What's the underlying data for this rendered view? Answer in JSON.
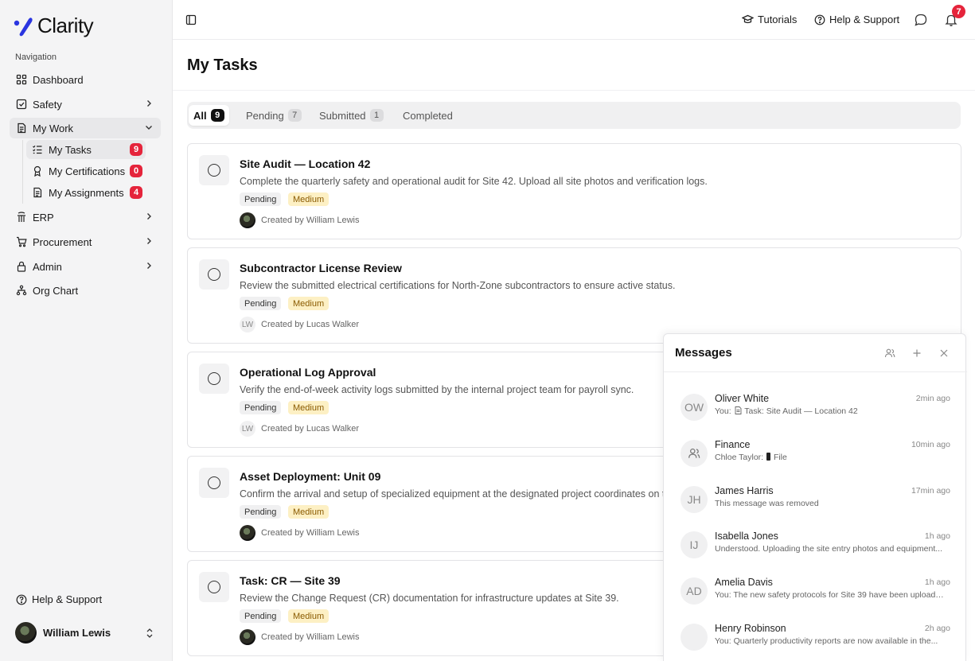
{
  "app": {
    "name": "Clarity"
  },
  "colors": {
    "brand": "#2a35e0",
    "badge_red": "#e5243b",
    "priority_bg": "#fdf0c4"
  },
  "sidebar": {
    "caption": "Navigation",
    "items": [
      {
        "label": "Dashboard",
        "icon": "grid-icon"
      },
      {
        "label": "Safety",
        "icon": "checkbox-icon"
      },
      {
        "label": "My Work",
        "icon": "document-icon"
      },
      {
        "label": "ERP",
        "icon": "plant-icon"
      },
      {
        "label": "Procurement",
        "icon": "cart-icon"
      },
      {
        "label": "Admin",
        "icon": "lock-icon"
      },
      {
        "label": "Org Chart",
        "icon": "hierarchy-icon"
      }
    ],
    "sub_items": [
      {
        "label": "My Tasks",
        "count": "9",
        "icon": "tasks-list-icon"
      },
      {
        "label": "My Certifications",
        "count": "0",
        "icon": "award-icon"
      },
      {
        "label": "My Assignments",
        "count": "4",
        "icon": "clipboard-icon"
      }
    ],
    "help_label": "Help & Support",
    "user_name": "William Lewis"
  },
  "topbar": {
    "tutorials_label": "Tutorials",
    "help_label": "Help & Support",
    "notification_count": "7"
  },
  "page": {
    "title": "My Tasks",
    "tabs": [
      {
        "label": "All",
        "count": "9"
      },
      {
        "label": "Pending",
        "count": "7"
      },
      {
        "label": "Submitted",
        "count": "1"
      },
      {
        "label": "Completed",
        "count": ""
      }
    ]
  },
  "tasks": [
    {
      "title": "Site Audit — Location 42",
      "description": "Complete the quarterly safety and operational audit for Site 42. Upload all site photos and verification logs.",
      "status": "Pending",
      "priority": "Medium",
      "creator": "Created by William Lewis",
      "creator_initials": ""
    },
    {
      "title": "Subcontractor License Review",
      "description": "Review the submitted electrical certifications for North-Zone subcontractors to ensure active status.",
      "status": "Pending",
      "priority": "Medium",
      "creator": "Created by Lucas Walker",
      "creator_initials": "LW"
    },
    {
      "title": "Operational Log Approval",
      "description": "Verify the end-of-week activity logs submitted by the internal project team for payroll sync.",
      "status": "Pending",
      "priority": "Medium",
      "creator": "Created by Lucas Walker",
      "creator_initials": "LW"
    },
    {
      "title": "Asset Deployment: Unit 09",
      "description": "Confirm the arrival and setup of specialized equipment at the designated project coordinates on th",
      "status": "Pending",
      "priority": "Medium",
      "creator": "Created by William Lewis",
      "creator_initials": ""
    },
    {
      "title": "Task: CR — Site 39",
      "description": "Review the Change Request (CR) documentation for infrastructure updates at Site 39.",
      "status": "Pending",
      "priority": "Medium",
      "creator": "Created by William Lewis",
      "creator_initials": ""
    }
  ],
  "messages": {
    "title": "Messages",
    "items": [
      {
        "name": "Oliver White",
        "initials": "OW",
        "time": "2min ago",
        "preview_prefix": "You:",
        "preview": "Task: Site Audit — Location 42",
        "preview_icon": "document-icon"
      },
      {
        "name": "Finance",
        "initials": "",
        "time": "10min ago",
        "preview_prefix": "Chloe Taylor:",
        "preview": "File",
        "preview_icon": "phone-icon"
      },
      {
        "name": "James Harris",
        "initials": "JH",
        "time": "17min ago",
        "preview_prefix": "",
        "preview": "This message was removed",
        "preview_icon": ""
      },
      {
        "name": "Isabella Jones",
        "initials": "IJ",
        "time": "1h ago",
        "preview_prefix": "",
        "preview": "Understood. Uploading the site entry photos and equipment...",
        "preview_icon": ""
      },
      {
        "name": "Amelia Davis",
        "initials": "AD",
        "time": "1h ago",
        "preview_prefix": "You:",
        "preview": "The new safety protocols for Site 39 have been uploaded...",
        "preview_icon": ""
      },
      {
        "name": "Henry Robinson",
        "initials": "",
        "time": "2h ago",
        "preview_prefix": "You:",
        "preview": "Quarterly productivity reports are now available in the...",
        "preview_icon": ""
      }
    ]
  }
}
